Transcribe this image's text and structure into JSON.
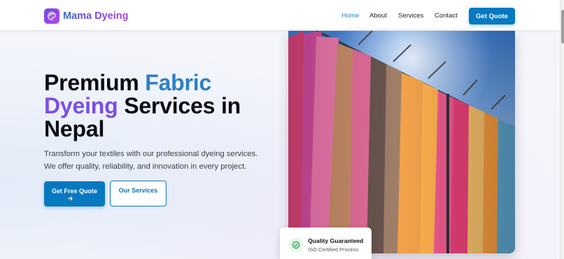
{
  "header": {
    "brand_name": "Mama Dyeing",
    "brand_icon": "palette-icon",
    "nav": [
      {
        "label": "Home",
        "active": true
      },
      {
        "label": "About",
        "active": false
      },
      {
        "label": "Services",
        "active": false
      },
      {
        "label": "Contact",
        "active": false
      }
    ],
    "cta_label": "Get Quote"
  },
  "hero": {
    "title_part1": "Premium ",
    "title_highlight1": "Fabric",
    "title_highlight2": "Dyeing",
    "title_part2": " Services in Nepal",
    "description": "Transform your textiles with our professional dyeing services. We offer quality, reliability, and innovation in every project.",
    "primary_button": "Get Free Quote",
    "primary_button_icon": "arrow-right-icon",
    "secondary_button": "Our Services",
    "image_subject": "dyed-fabric-drying-rack",
    "badge": {
      "icon": "check-circle-icon",
      "title": "Quality Guaranteed",
      "subtitle": "ISO Certified Process"
    }
  },
  "colors": {
    "primary": "#0779c1",
    "accent_blue": "#2f7fc4",
    "accent_purple": "#7b4fe0",
    "success": "#22a04b"
  }
}
